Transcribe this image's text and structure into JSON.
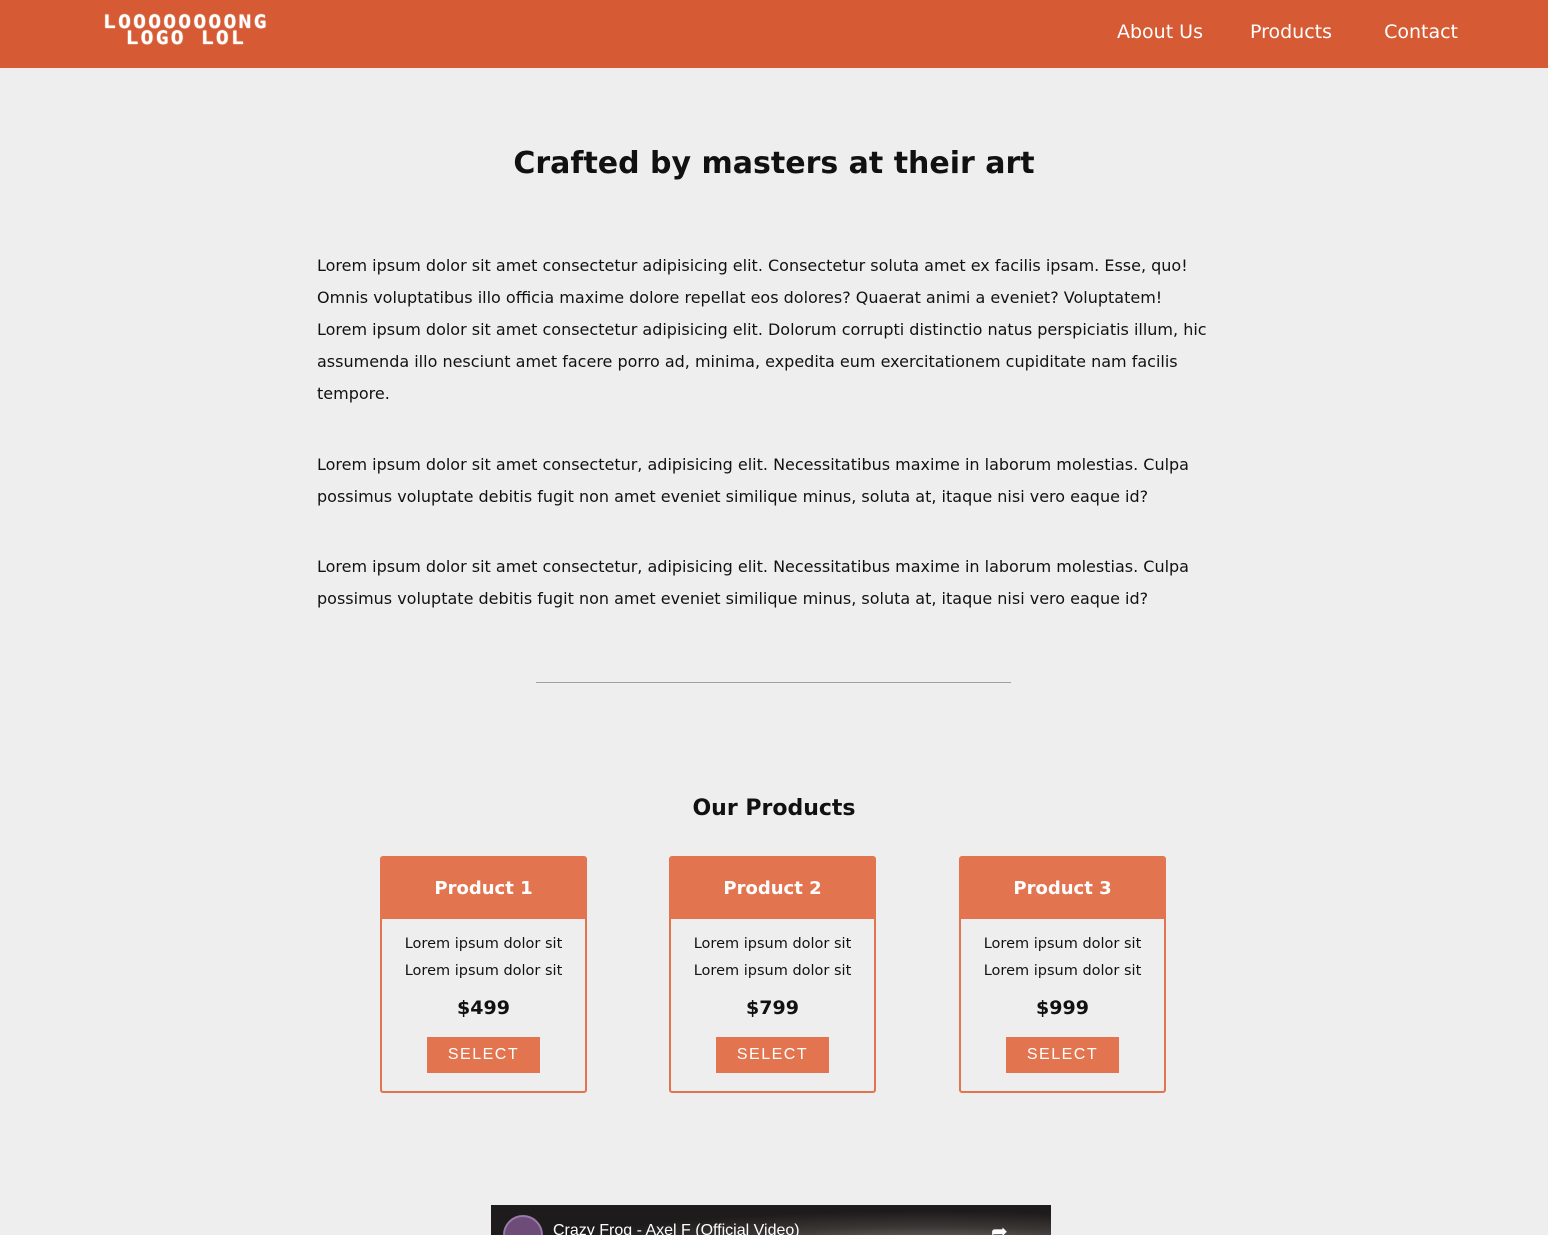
{
  "header": {
    "logo_line1": "LOOOOOOOONG",
    "logo_line2": "LOGO LOL",
    "nav": [
      "About Us",
      "Products",
      "Contact"
    ]
  },
  "main": {
    "title": "Crafted by masters at their art",
    "paragraphs": [
      "Lorem ipsum dolor sit amet consectetur adipisicing elit. Consectetur soluta amet ex facilis ipsam. Esse, quo! Omnis voluptatibus illo officia maxime dolore repellat eos dolores? Quaerat animi a eveniet? Voluptatem! Lorem ipsum dolor sit amet consectetur adipisicing elit. Dolorum corrupti distinctio natus perspiciatis illum, hic assumenda illo nesciunt amet facere porro ad, minima, expedita eum exercitationem cupiditate nam facilis tempore.",
      "Lorem ipsum dolor sit amet consectetur, adipisicing elit. Necessitatibus maxime in laborum molestias. Culpa possimus voluptate debitis fugit non amet eveniet similique minus, soluta at, itaque nisi vero eaque id?",
      "Lorem ipsum dolor sit amet consectetur, adipisicing elit. Necessitatibus maxime in laborum molestias. Culpa possimus voluptate debitis fugit non amet eveniet similique minus, soluta at, itaque nisi vero eaque id?"
    ]
  },
  "products": {
    "title": "Our Products",
    "items": [
      {
        "name": "Product 1",
        "line1": "Lorem ipsum dolor sit",
        "line2": "Lorem ipsum dolor sit",
        "price": "$499",
        "button": "SELECT"
      },
      {
        "name": "Product 2",
        "line1": "Lorem ipsum dolor sit",
        "line2": "Lorem ipsum dolor sit",
        "price": "$799",
        "button": "SELECT"
      },
      {
        "name": "Product 3",
        "line1": "Lorem ipsum dolor sit",
        "line2": "Lorem ipsum dolor sit",
        "price": "$999",
        "button": "SELECT"
      }
    ]
  },
  "video": {
    "title": "Crazy Frog - Axel F (Official Video)",
    "share_icon": "share-icon"
  },
  "colors": {
    "header": "#d65a33",
    "accent": "#e2744f",
    "background": "#eeeeee"
  }
}
